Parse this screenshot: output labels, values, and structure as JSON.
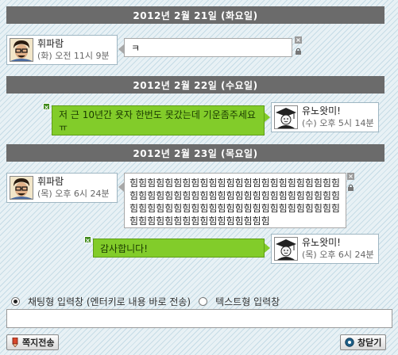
{
  "conversation": [
    {
      "date": "2012년 2월 21일 (화요일)",
      "messages": [
        {
          "sender": "휘파람",
          "time": "(화) 오전 11시 9분",
          "text": "ㅋ"
        }
      ]
    },
    {
      "date": "2012년 2월 22일 (수요일)",
      "messages": [
        {
          "sender": "유노왓미!",
          "time": "(수) 오후 5시 14분",
          "text": "저 근 10년간 욧자 한번도 못갔는데 기운좀주세요 ㅠ"
        }
      ]
    },
    {
      "date": "2012년 2월 23일 (목요일)",
      "messages": [
        {
          "sender": "휘파람",
          "time": "(목) 오후 6시 24분",
          "text": "힘힘힘힘힘힘힘힘힘힘힘힘힘힘힘힘힘힘힘힘힘힘힘힘힘힘힘힘힘힘힘힘힘힘힘힘힘힘힘힘힘힘힘힘힘힘힘힘힘힘힘힘힘힘힘힘힘힘힘힘힘힘힘힘힘힘힘힘힘힘힘힘힘힘힘힘힘힘힘힘힘힘힘힘힘힘힘힘"
        },
        {
          "sender": "유노왓미!",
          "time": "(목) 오후 6시 24분",
          "text": "감사합니다!"
        }
      ]
    }
  ],
  "input_mode": {
    "option_chat": "채팅형 입력창 (엔터키로 내용 바로 전송)",
    "option_text": "텍스트형 입력창",
    "selected": "chat"
  },
  "input": {
    "value": "",
    "placeholder": ""
  },
  "buttons": {
    "send_note": "쪽지전송",
    "close_window": "창닫기"
  },
  "icons": {
    "message_delete": "close-icon",
    "message_lock": "lock-icon",
    "send_note": "pencil-icon",
    "close_window": "close-circle-icon"
  },
  "colors": {
    "date_bar": "#6b6b6b",
    "my_bubble": "#82cc2a",
    "other_bubble": "#ffffff"
  }
}
